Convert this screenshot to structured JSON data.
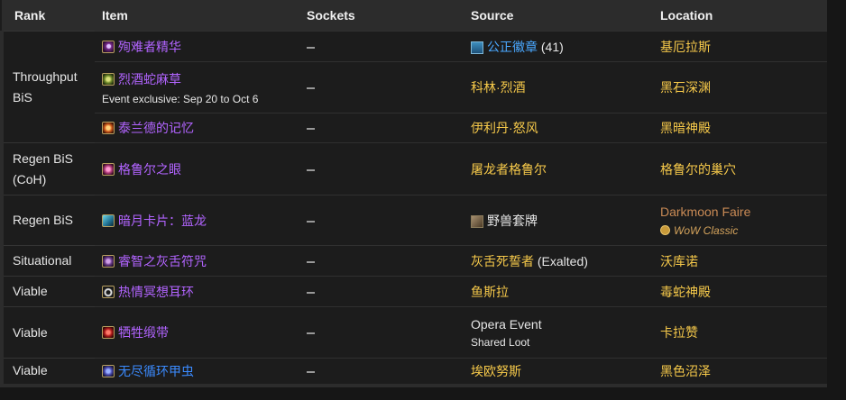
{
  "headers": [
    "Rank",
    "Item",
    "Sockets",
    "Source",
    "Location"
  ],
  "colors": {
    "epic": "#b264ff",
    "rare": "#3b8bff",
    "source": "#f6c94a",
    "darkmoon": "#c98a55"
  },
  "rows": [
    {
      "item": "殉难者精华",
      "item_color": "epic",
      "icon": "essence-icon",
      "source": "公正徽章",
      "source_extra": "(41)",
      "source_icon": "badge-of-justice-icon",
      "location": "基厄拉斯"
    },
    {
      "item": "烈酒蛇麻草",
      "item_color": "epic",
      "icon": "hops-icon",
      "sub": "Event exclusive: Sep 20 to Oct 6",
      "source": "科林·烈酒",
      "location": "黑石深渊"
    },
    {
      "item": "泰兰德的记忆",
      "item_color": "epic",
      "icon": "memento-icon",
      "source": "伊利丹·怒风",
      "location": "黑暗神殿"
    },
    {
      "item": "格鲁尔之眼",
      "item_color": "epic",
      "icon": "eye-icon",
      "source": "屠龙者格鲁尔",
      "location": "格鲁尔的巢穴"
    },
    {
      "item": "暗月卡片：蓝龙",
      "item_color": "epic",
      "icon": "card-icon",
      "source": "野兽套牌",
      "source_icon": "deck-icon",
      "location": "Darkmoon Faire",
      "location_sub": "WoW Classic"
    },
    {
      "item": "睿智之灰舌符咒",
      "item_color": "epic",
      "icon": "charm-icon",
      "source": "灰舌死誓者",
      "source_extra": "(Exalted)",
      "location": "沃库诺"
    },
    {
      "item": "热情冥想耳环",
      "item_color": "epic",
      "icon": "ring-icon",
      "source": "鱼斯拉",
      "location": "毒蛇神殿"
    },
    {
      "item": "牺牲缎带",
      "item_color": "epic",
      "icon": "ribbon-icon",
      "source": "Opera Event",
      "source_sub": "Shared Loot",
      "location": "卡拉赞"
    },
    {
      "item": "无尽循环甲虫",
      "item_color": "rare",
      "icon": "scarab-icon",
      "source": "埃欧努斯",
      "location": "黑色沼泽"
    }
  ],
  "ranks": [
    {
      "label": "Throughput BiS"
    },
    {
      "label": "Regen BiS (CoH)"
    },
    {
      "label": "Regen BiS"
    },
    {
      "label": "Situational"
    },
    {
      "label": "Viable"
    },
    {
      "label": "Viable"
    },
    {
      "label": "Viable"
    }
  ]
}
